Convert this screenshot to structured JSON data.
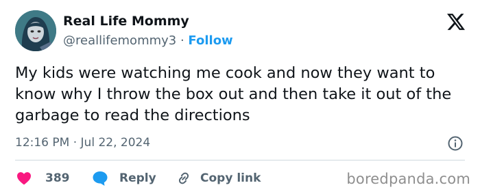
{
  "author": {
    "display_name": "Real Life Mommy",
    "handle": "@reallifemommy3",
    "separator": " · ",
    "follow_label": "Follow"
  },
  "tweet": {
    "text": "My kids were watching me cook and now they want to know why I throw the box out and then take it out of the garbage to read the directions",
    "timestamp": "12:16 PM · Jul 22, 2024"
  },
  "actions": {
    "like_count": "389",
    "reply_label": "Reply",
    "copy_link_label": "Copy link"
  },
  "watermark": "boredpanda.com",
  "icons": {
    "brand": "x-logo-icon",
    "info": "info-icon",
    "like": "heart-icon",
    "reply": "speech-bubble-icon",
    "copy": "link-icon"
  },
  "colors": {
    "accent": "#1d9bf0",
    "like": "#f91880",
    "text": "#0f1419",
    "muted": "#536471"
  }
}
